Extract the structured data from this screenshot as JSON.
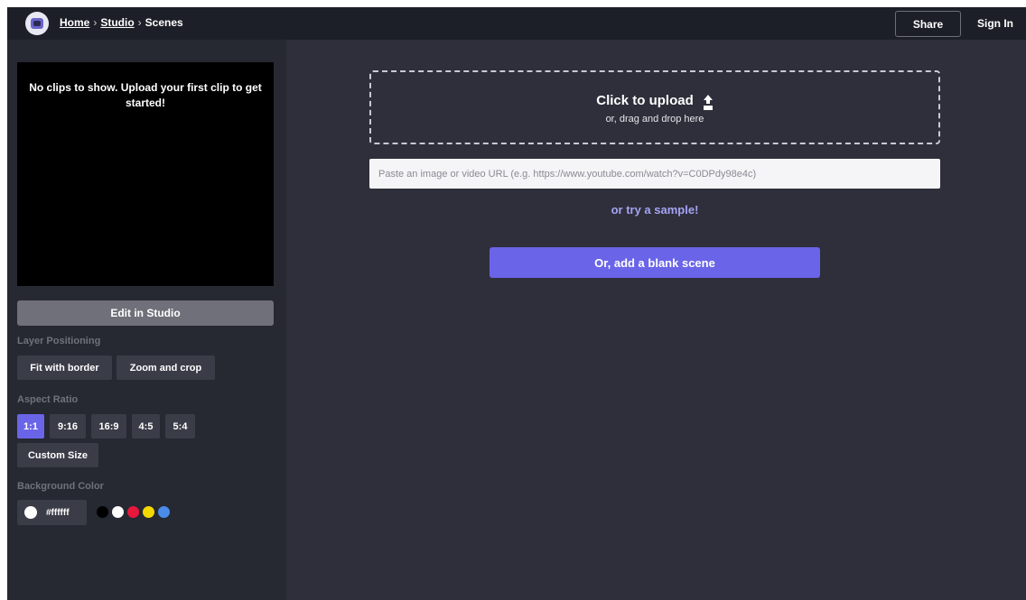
{
  "breadcrumb": {
    "home": "Home",
    "sep1": "›",
    "studio": "Studio",
    "sep2": "›",
    "current": "Scenes"
  },
  "header": {
    "share_label": "Share",
    "signin_label": "Sign In"
  },
  "sidebar": {
    "preview_message": "No clips to show. Upload your first clip to get started!",
    "edit_label": "Edit in Studio",
    "layer_positioning": {
      "label": "Layer Positioning",
      "options": [
        "Fit with border",
        "Zoom and crop"
      ]
    },
    "aspect_ratio": {
      "label": "Aspect Ratio",
      "options": [
        "1:1",
        "9:16",
        "16:9",
        "4:5",
        "5:4"
      ],
      "selected": "1:1",
      "custom_label": "Custom Size"
    },
    "background_color": {
      "label": "Background Color",
      "value": "#ffffff",
      "palette": [
        "#000000",
        "#ffffff",
        "#e8173b",
        "#f5d800",
        "#4a8be8"
      ]
    }
  },
  "main": {
    "upload_title": "Click to upload",
    "upload_sub": "or, drag and drop here",
    "url_placeholder": "Paste an image or video URL (e.g. https://www.youtube.com/watch?v=C0DPdy98e4c)",
    "sample_label": "or try a sample!",
    "blank_scene_label": "Or, add a blank scene"
  },
  "colors": {
    "accent": "#6a64e8",
    "nav_bg": "#1d1f28",
    "sidebar_bg": "#262832",
    "main_bg": "#2e2f3a"
  }
}
